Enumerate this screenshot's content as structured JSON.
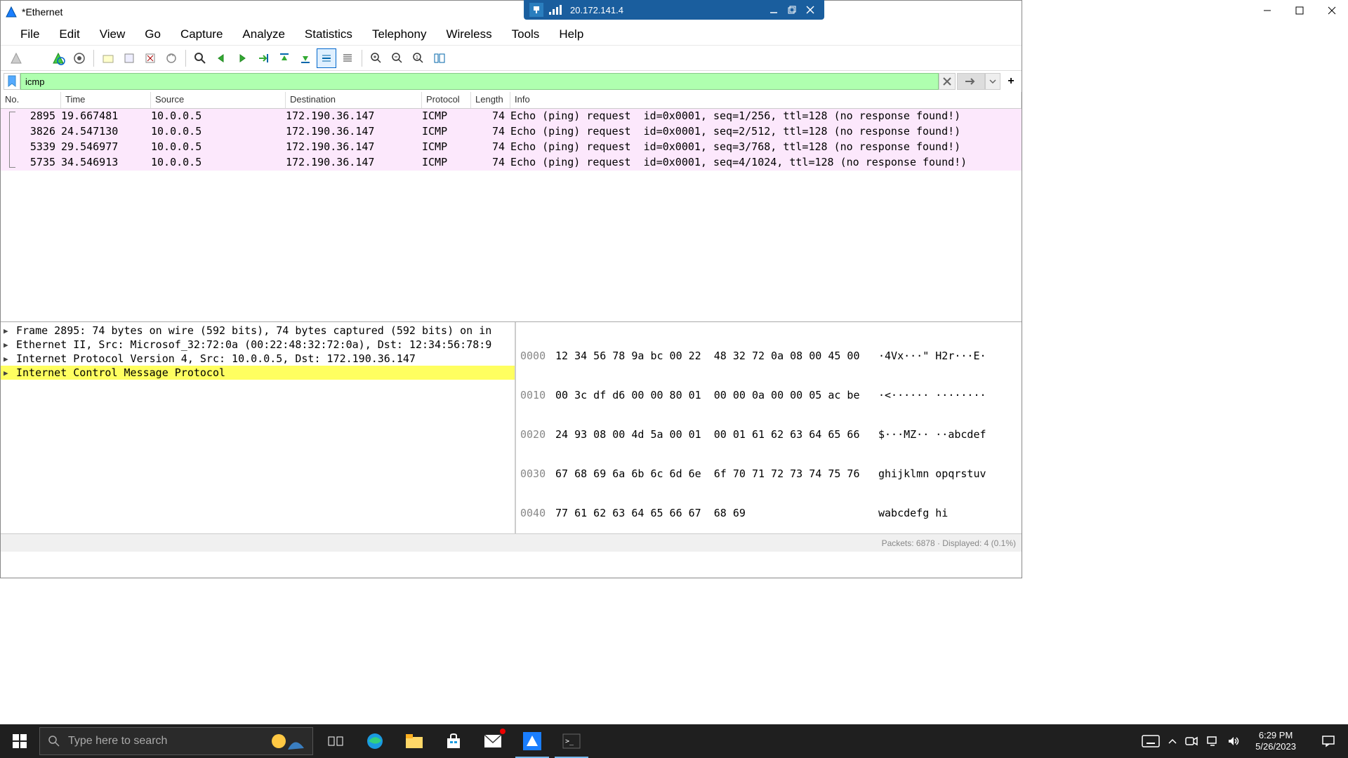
{
  "remote": {
    "ip": "20.172.141.4"
  },
  "window": {
    "title": "*Ethernet"
  },
  "menu": [
    "File",
    "Edit",
    "View",
    "Go",
    "Capture",
    "Analyze",
    "Statistics",
    "Telephony",
    "Wireless",
    "Tools",
    "Help"
  ],
  "filter": {
    "value": "icmp"
  },
  "columns": {
    "no": "No.",
    "time": "Time",
    "source": "Source",
    "destination": "Destination",
    "protocol": "Protocol",
    "length": "Length",
    "info": "Info"
  },
  "packets": [
    {
      "no": "2895",
      "time": "19.667481",
      "src": "10.0.0.5",
      "dst": "172.190.36.147",
      "proto": "ICMP",
      "len": "74",
      "info": "Echo (ping) request  id=0x0001, seq=1/256, ttl=128 (no response found!)"
    },
    {
      "no": "3826",
      "time": "24.547130",
      "src": "10.0.0.5",
      "dst": "172.190.36.147",
      "proto": "ICMP",
      "len": "74",
      "info": "Echo (ping) request  id=0x0001, seq=2/512, ttl=128 (no response found!)"
    },
    {
      "no": "5339",
      "time": "29.546977",
      "src": "10.0.0.5",
      "dst": "172.190.36.147",
      "proto": "ICMP",
      "len": "74",
      "info": "Echo (ping) request  id=0x0001, seq=3/768, ttl=128 (no response found!)"
    },
    {
      "no": "5735",
      "time": "34.546913",
      "src": "10.0.0.5",
      "dst": "172.190.36.147",
      "proto": "ICMP",
      "len": "74",
      "info": "Echo (ping) request  id=0x0001, seq=4/1024, ttl=128 (no response found!)"
    }
  ],
  "details": [
    "Frame 2895: 74 bytes on wire (592 bits), 74 bytes captured (592 bits) on in",
    "Ethernet II, Src: Microsof_32:72:0a (00:22:48:32:72:0a), Dst: 12:34:56:78:9",
    "Internet Protocol Version 4, Src: 10.0.0.5, Dst: 172.190.36.147",
    "Internet Control Message Protocol"
  ],
  "bytes": [
    {
      "off": "0000",
      "hex": "12 34 56 78 9a bc 00 22  48 32 72 0a 08 00 45 00",
      "asc": "·4Vx···\" H2r···E·"
    },
    {
      "off": "0010",
      "hex": "00 3c df d6 00 00 80 01  00 00 0a 00 00 05 ac be",
      "asc": "·<······ ········"
    },
    {
      "off": "0020",
      "hex": "24 93 08 00 4d 5a 00 01  00 01 61 62 63 64 65 66",
      "asc": "$···MZ·· ··abcdef"
    },
    {
      "off": "0030",
      "hex": "67 68 69 6a 6b 6c 6d 6e  6f 70 71 72 73 74 75 76",
      "asc": "ghijklmn opqrstuv"
    },
    {
      "off": "0040",
      "hex": "77 61 62 63 64 65 66 67  68 69",
      "asc": "wabcdefg hi"
    }
  ],
  "status": {
    "packets": "Packets: 6878 · Displayed: 4 (0.1%)"
  },
  "taskbar": {
    "search_placeholder": "Type here to search",
    "time": "6:29 PM",
    "date": "5/26/2023"
  }
}
